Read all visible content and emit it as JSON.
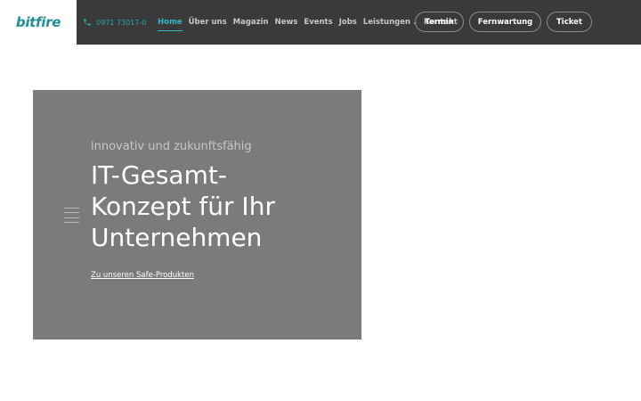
{
  "header": {
    "logo": "bitfire",
    "phone": "0971 73017-0",
    "nav": [
      {
        "label": "Home",
        "active": true
      },
      {
        "label": "Über uns"
      },
      {
        "label": "Magazin"
      },
      {
        "label": "News"
      },
      {
        "label": "Events"
      },
      {
        "label": "Jobs"
      },
      {
        "label": "Leistungen",
        "has_dropdown": true
      },
      {
        "label": "Kontakt"
      }
    ],
    "buttons": {
      "termin": "Termin",
      "fernwartung": "Fernwartung",
      "ticket": "Ticket"
    }
  },
  "hero": {
    "subtitle": "innovativ und zukunftsfähig",
    "title_lines": [
      "IT-Gesamt-",
      "Konzept für Ihr",
      "Unternehmen"
    ],
    "link": "Zu unseren Safe-Produkten"
  },
  "colors": {
    "accent": "#35b7c2",
    "topbar": "#3a3a3a",
    "hero_bg": "#7b7b7a"
  },
  "icons": {
    "phone": "phone-icon",
    "dropdown": "chevron-down-icon",
    "menu": "hamburger-icon"
  }
}
